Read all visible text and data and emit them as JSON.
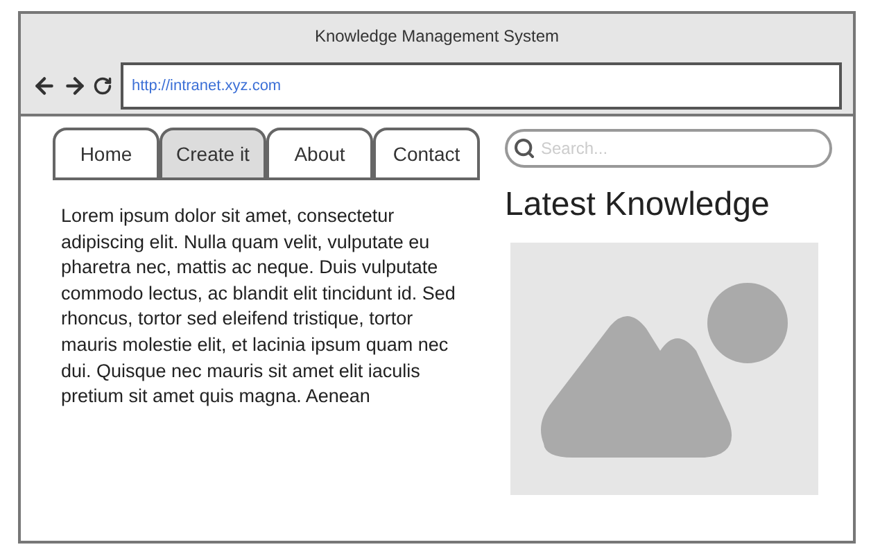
{
  "window": {
    "title": "Knowledge Management System"
  },
  "address_bar": {
    "url": "http://intranet.xyz.com"
  },
  "tabs": [
    {
      "label": "Home",
      "selected": false
    },
    {
      "label": "Create it",
      "selected": true
    },
    {
      "label": "About",
      "selected": false
    },
    {
      "label": "Contact",
      "selected": false
    }
  ],
  "body_text": "Lorem ipsum dolor sit amet, consectetur adipiscing elit. Nulla quam velit, vulputate eu pharetra nec, mattis ac neque. Duis vulputate commodo lectus, ac blandit elit tincidunt id. Sed rhoncus, tortor sed eleifend tristique, tortor mauris molestie elit, et lacinia ipsum quam nec dui. Quisque nec mauris sit amet elit iaculis pretium sit amet quis magna. Aenean",
  "search": {
    "placeholder": "Search..."
  },
  "sidebar": {
    "heading": "Latest Knowledge"
  }
}
